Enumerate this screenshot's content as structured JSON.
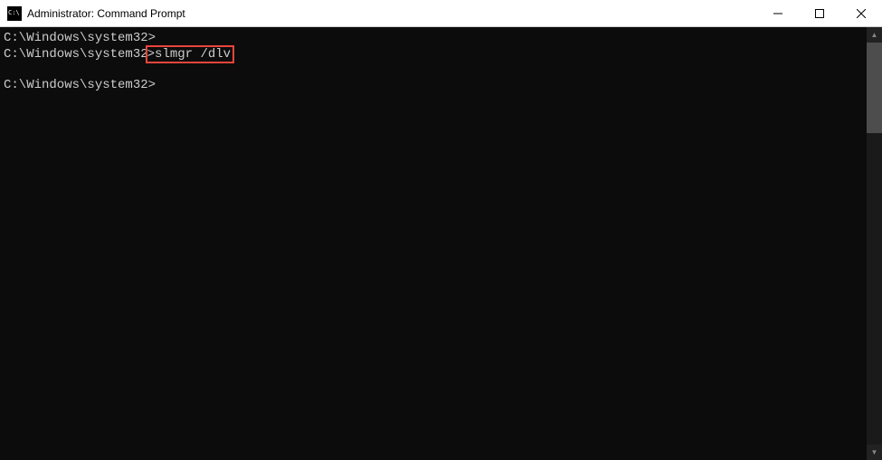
{
  "window": {
    "title": "Administrator: Command Prompt"
  },
  "terminal": {
    "lines": [
      {
        "prompt": "C:\\Windows\\system32>",
        "command": "",
        "highlighted": false
      },
      {
        "prompt": "C:\\Windows\\system32",
        "chevron": ">",
        "command": "slmgr /dlv",
        "highlighted": true
      },
      {
        "blank": true
      },
      {
        "prompt": "C:\\Windows\\system32>",
        "command": "",
        "highlighted": false
      }
    ]
  }
}
